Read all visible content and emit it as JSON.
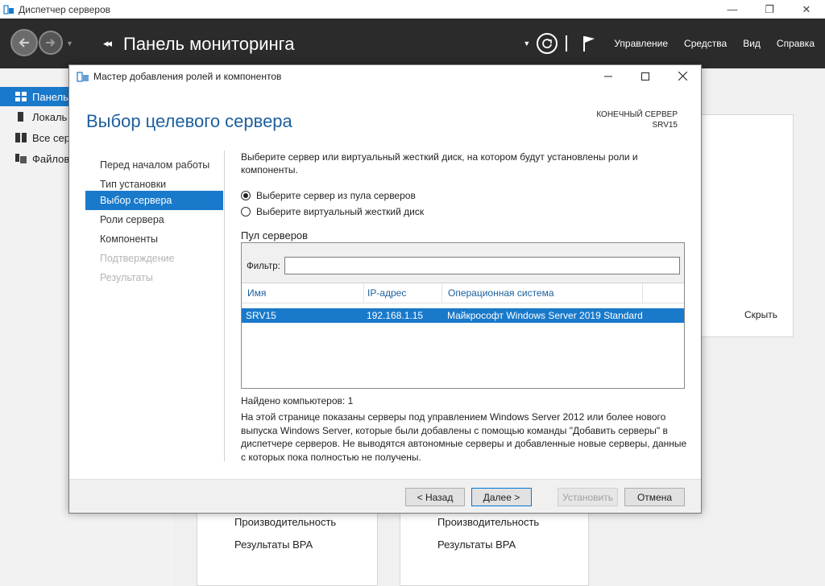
{
  "window": {
    "title": "Диспетчер серверов",
    "controls": {
      "minimize": "—",
      "restore": "❐",
      "close": "✕"
    }
  },
  "toolbar": {
    "breadcrumb_arrow": "◂◂",
    "page_title": "Панель мониторинга",
    "menu": [
      "Управление",
      "Средства",
      "Вид",
      "Справка"
    ]
  },
  "leftnav": {
    "items": [
      {
        "label": "Панель",
        "active": true,
        "icon": "dashboard-icon"
      },
      {
        "label": "Локаль",
        "active": false,
        "icon": "local-server-icon"
      },
      {
        "label": "Все сер",
        "active": false,
        "icon": "all-servers-icon"
      },
      {
        "label": "Файлов",
        "active": false,
        "icon": "file-services-icon"
      }
    ]
  },
  "dashboard": {
    "hide_link": "Скрыть",
    "tiles": [
      {
        "lines": [
          "Производительность",
          "Результаты BPA"
        ]
      },
      {
        "lines": [
          "Производительность",
          "Результаты BPA"
        ]
      }
    ]
  },
  "wizard": {
    "title": "Мастер добавления ролей и компонентов",
    "heading": "Выбор целевого сервера",
    "destination_label": "КОНЕЧНЫЙ СЕРВЕР",
    "destination_server": "SRV15",
    "steps": [
      {
        "label": "Перед началом работы",
        "state": "normal"
      },
      {
        "label": "Тип установки",
        "state": "normal"
      },
      {
        "label": "Выбор сервера",
        "state": "current"
      },
      {
        "label": "Роли сервера",
        "state": "normal"
      },
      {
        "label": "Компоненты",
        "state": "normal"
      },
      {
        "label": "Подтверждение",
        "state": "disabled"
      },
      {
        "label": "Результаты",
        "state": "disabled"
      }
    ],
    "description": "Выберите сервер или виртуальный жесткий диск, на котором будут установлены роли и компоненты.",
    "radio_pool": "Выберите сервер из пула серверов",
    "radio_vhd": "Выберите виртуальный жесткий диск",
    "pool_label": "Пул серверов",
    "filter_label": "Фильтр:",
    "filter_value": "",
    "columns": [
      "Имя",
      "IP-адрес",
      "Операционная система"
    ],
    "rows": [
      {
        "name": "SRV15",
        "ip": "192.168.1.15",
        "os": "Майкрософт Windows Server 2019 Standard"
      }
    ],
    "found": "Найдено компьютеров: 1",
    "note": "На этой странице показаны серверы под управлением Windows Server 2012 или более нового выпуска Windows Server, которые были добавлены с помощью команды \"Добавить серверы\" в диспетчере серверов. Не выводятся автономные серверы и добавленные новые серверы, данные с которых пока полностью не получены.",
    "buttons": {
      "back": "< Назад",
      "next": "Далее >",
      "install": "Установить",
      "cancel": "Отмена"
    }
  },
  "colors": {
    "accent": "#1979ca",
    "toolbar_bg": "#2b2b2b",
    "heading": "#1c5f9e"
  }
}
